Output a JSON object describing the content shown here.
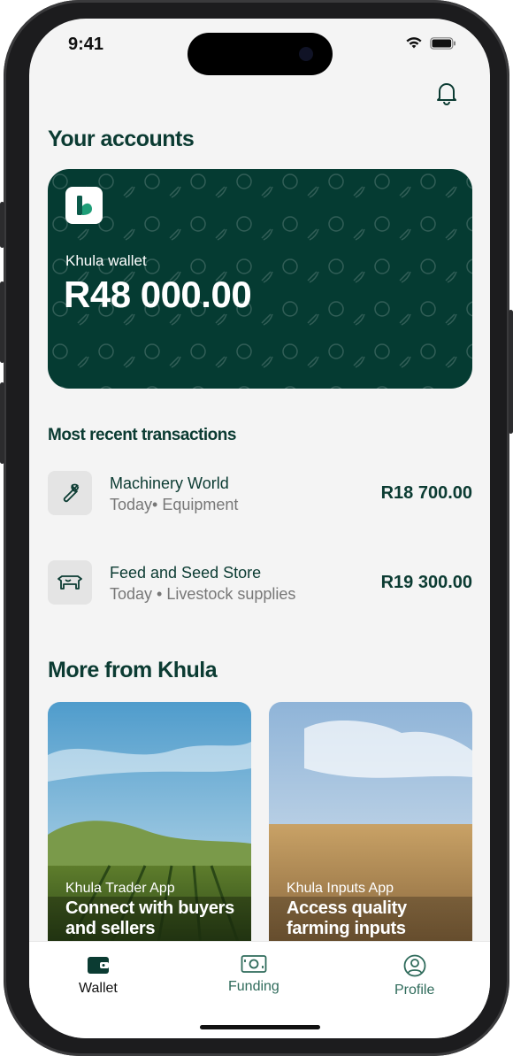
{
  "status": {
    "time": "9:41"
  },
  "header": {
    "title": "Your accounts"
  },
  "wallet": {
    "label": "Khula wallet",
    "balance": "R48 000.00",
    "logo_letter": "k"
  },
  "transactions": {
    "title": "Most recent transactions",
    "items": [
      {
        "name": "Machinery World",
        "sub": "Today• Equipment",
        "amount": "R18 700.00",
        "icon": "wrench-icon"
      },
      {
        "name": "Feed and Seed Store",
        "sub": "Today • Livestock supplies",
        "amount": "R19 300.00",
        "icon": "cow-icon"
      }
    ]
  },
  "more": {
    "title": "More from Khula",
    "cards": [
      {
        "label": "Khula Trader App",
        "title": "Connect with buyers and sellers"
      },
      {
        "label": "Khula Inputs App",
        "title": "Access quality farming inputs"
      }
    ]
  },
  "nav": {
    "items": [
      {
        "label": "Wallet",
        "icon": "wallet-icon",
        "active": true
      },
      {
        "label": "Funding",
        "icon": "cash-icon",
        "active": false
      },
      {
        "label": "Profile",
        "icon": "user-circle-icon",
        "active": false
      }
    ]
  },
  "colors": {
    "brand": "#053b32",
    "text_dark": "#0b3b32",
    "muted": "#777777",
    "background": "#f4f4f4"
  }
}
